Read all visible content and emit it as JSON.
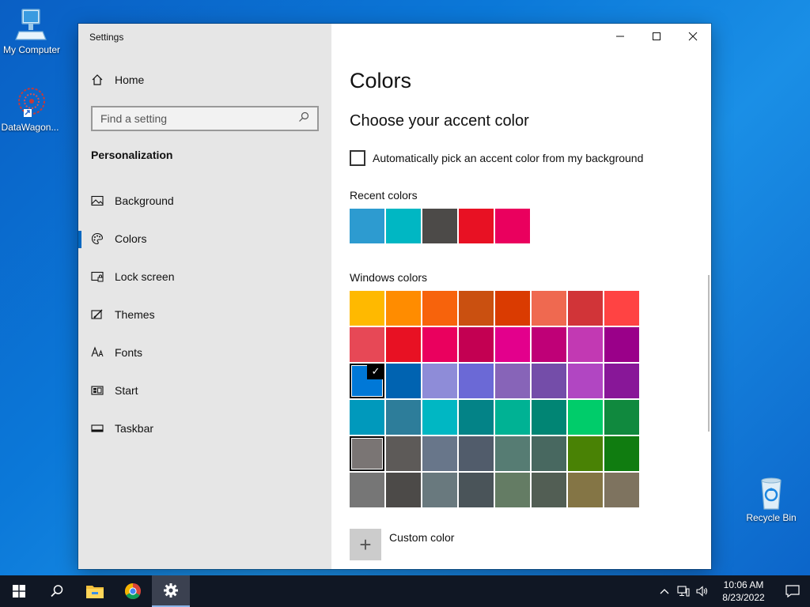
{
  "desktop": {
    "icons": [
      {
        "label": "My Computer"
      },
      {
        "label": "DataWagon..."
      },
      {
        "label": "Recycle Bin"
      }
    ]
  },
  "window": {
    "app_title": "Settings",
    "sidebar": {
      "home_label": "Home",
      "search_placeholder": "Find a setting",
      "section_title": "Personalization",
      "items": [
        {
          "label": "Background",
          "icon": "picture-icon"
        },
        {
          "label": "Colors",
          "icon": "palette-icon",
          "active": true
        },
        {
          "label": "Lock screen",
          "icon": "lock-screen-icon"
        },
        {
          "label": "Themes",
          "icon": "themes-icon"
        },
        {
          "label": "Fonts",
          "icon": "fonts-icon"
        },
        {
          "label": "Start",
          "icon": "start-icon"
        },
        {
          "label": "Taskbar",
          "icon": "taskbar-icon"
        }
      ]
    },
    "content": {
      "page_title": "Colors",
      "subtitle": "Choose your accent color",
      "auto_pick_label": "Automatically pick an accent color from my background",
      "auto_pick_checked": false,
      "recent_label": "Recent colors",
      "recent_colors": [
        "#2d9bd0",
        "#00b7c3",
        "#4c4a48",
        "#e81123",
        "#ea005e"
      ],
      "windows_label": "Windows colors",
      "windows_colors": [
        "#ffb900",
        "#ff8c00",
        "#f7630c",
        "#ca5010",
        "#da3b01",
        "#ef6950",
        "#d13438",
        "#ff4343",
        "#e74856",
        "#e81123",
        "#ea005e",
        "#c30052",
        "#e3008c",
        "#bf0077",
        "#c239b3",
        "#9a0089",
        "#0078d7",
        "#0063b1",
        "#8e8cd8",
        "#6b69d6",
        "#8764b8",
        "#744da9",
        "#b146c2",
        "#881798",
        "#0099bc",
        "#2d7d9a",
        "#00b7c3",
        "#038387",
        "#00b294",
        "#018574",
        "#00cc6a",
        "#10893e",
        "#7a7574",
        "#5d5a58",
        "#68768a",
        "#515c6b",
        "#567c73",
        "#486860",
        "#498205",
        "#107c10",
        "#767676",
        "#4c4a48",
        "#69797e",
        "#4a5459",
        "#647c64",
        "#525e54",
        "#847545",
        "#7e735f"
      ],
      "selected_index": 16,
      "outlined_index": 32,
      "custom_label": "Custom color",
      "custom_symbol": "+"
    }
  },
  "taskbar": {
    "time": "10:06 AM",
    "date": "8/23/2022"
  }
}
